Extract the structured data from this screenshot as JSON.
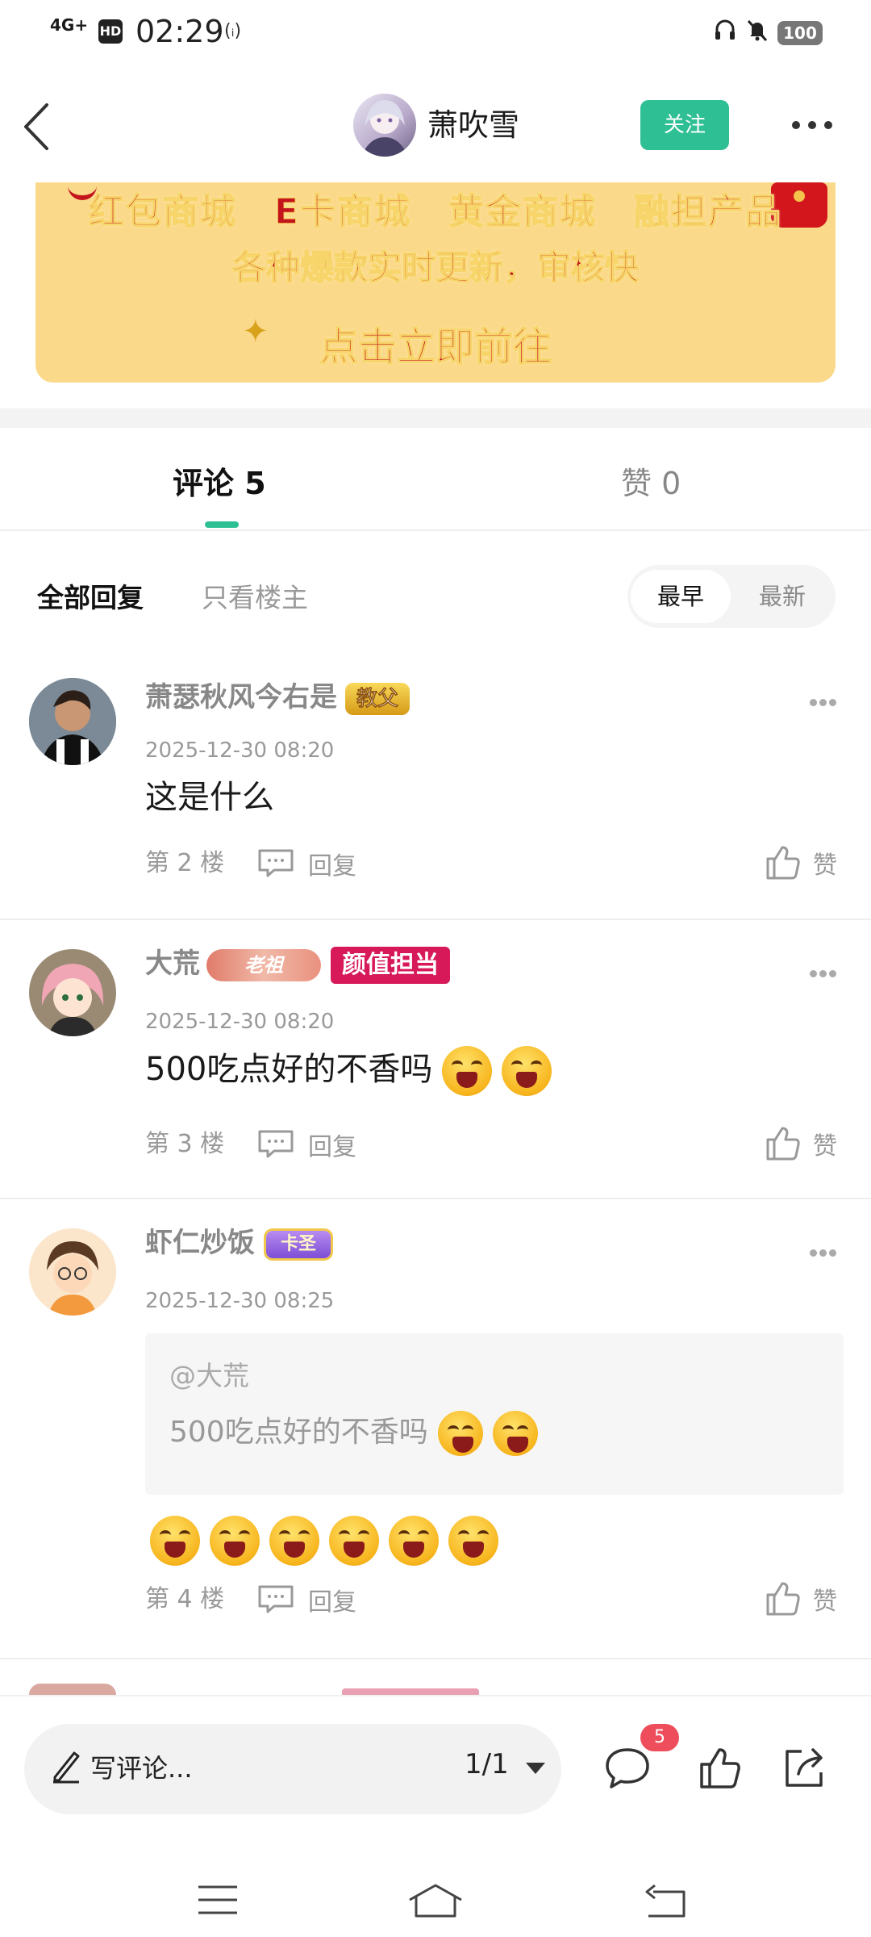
{
  "status_bar": {
    "network": "4G+",
    "hd": "HD",
    "time": "02:29",
    "signal_extra": "(ᵢ)",
    "battery": "100"
  },
  "header": {
    "username": "萧吹雪",
    "follow_label": "关注"
  },
  "banner": {
    "line1": "红包商城　E卡商城　黄金商城　融担产品",
    "line2": "各种爆款实时更新，审核快",
    "line3": "点击立即前往"
  },
  "tabs": {
    "comments": "评论 5",
    "likes": "赞 0"
  },
  "filter": {
    "all": "全部回复",
    "op_only": "只看楼主",
    "sort_earliest": "最早",
    "sort_latest": "最新"
  },
  "comments": [
    {
      "name": "萧瑟秋风今右是",
      "badge": "教父",
      "time": "2025-12-30 08:20",
      "text": "这是什么",
      "floor": "第 2 楼",
      "reply": "回复",
      "like": "赞"
    },
    {
      "name": "大荒",
      "badge": "老祖",
      "badge2": "颜值担当",
      "time": "2025-12-30 08:20",
      "text": "500吃点好的不香吗",
      "floor": "第 3 楼",
      "reply": "回复",
      "like": "赞"
    },
    {
      "name": "虾仁炒饭",
      "badge": "卡圣",
      "time": "2025-12-30 08:25",
      "quote_user": "@大荒",
      "quote_text": "500吃点好的不香吗",
      "floor": "第 4 楼",
      "reply": "回复",
      "like": "赞"
    }
  ],
  "bottom": {
    "placeholder": "写评论...",
    "page": "1/1",
    "comment_count": "5"
  },
  "colors": {
    "accent": "#2fbf94",
    "badge_red": "#ee4d5b",
    "banner_bg": "#fbd98b",
    "banner_text": "#c4151c"
  }
}
